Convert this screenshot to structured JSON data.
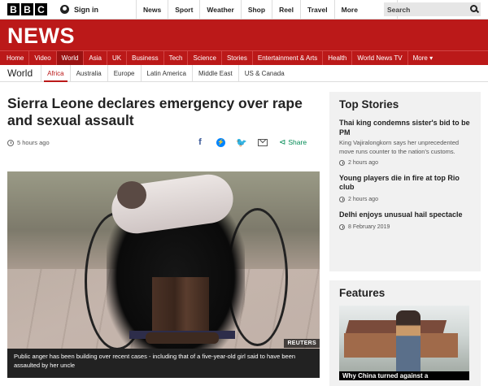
{
  "globalbar": {
    "logo_letters": [
      "B",
      "B",
      "C"
    ],
    "signin": "Sign in",
    "nav": [
      "News",
      "Sport",
      "Weather",
      "Shop",
      "Reel",
      "Travel"
    ],
    "more": "More",
    "search_placeholder": "Search"
  },
  "brand": {
    "title": "NEWS"
  },
  "sections": [
    "Home",
    "Video",
    "World",
    "Asia",
    "UK",
    "Business",
    "Tech",
    "Science",
    "Stories",
    "Entertainment & Arts",
    "Health",
    "World News TV",
    "More ▾"
  ],
  "active_section": "World",
  "subnav": {
    "title": "World",
    "items": [
      "Africa",
      "Australia",
      "Europe",
      "Latin America",
      "Middle East",
      "US & Canada"
    ],
    "active": "Africa"
  },
  "article": {
    "headline": "Sierra Leone declares emergency over rape and sexual assault",
    "time": "5 hours ago",
    "share_label": "Share",
    "image_credit": "REUTERS",
    "caption": "Public anger has been building over recent cases - including that of a five-year-old girl said to have been assaulted by her uncle"
  },
  "top_stories": {
    "heading": "Top Stories",
    "stories": [
      {
        "title": "Thai king condemns sister's bid to be PM",
        "summary": "King Vajiralongkorn says her unprecedented move runs counter to the nation's customs.",
        "time": "2 hours ago"
      },
      {
        "title": "Young players die in fire at top Rio club",
        "summary": "",
        "time": "2 hours ago"
      },
      {
        "title": "Delhi enjoys unusual hail spectacle",
        "summary": "",
        "time": "8 February 2019"
      }
    ]
  },
  "features": {
    "heading": "Features",
    "caption": "Why China turned against a"
  },
  "colors": {
    "brand_red": "#bb1919",
    "share_green": "#008a54"
  }
}
